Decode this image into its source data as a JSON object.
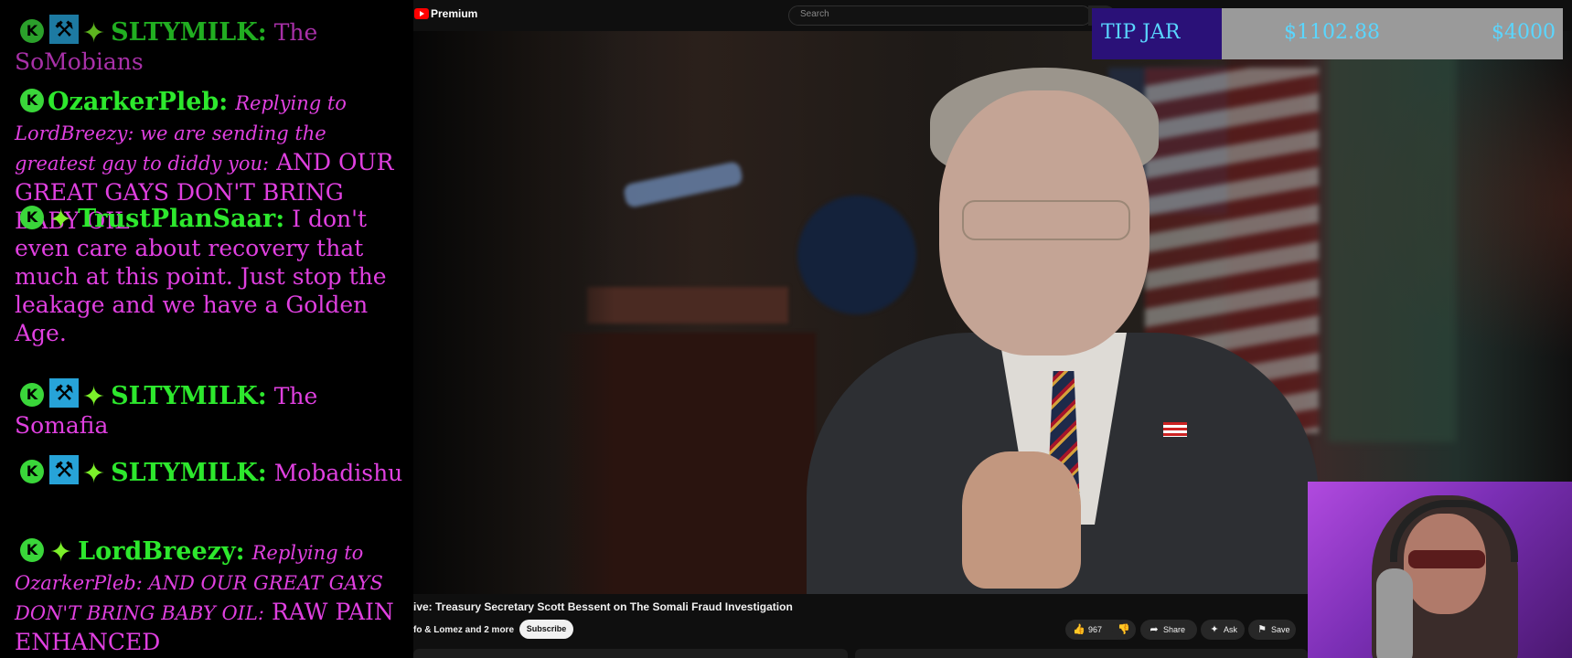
{
  "chat": {
    "messages": [
      {
        "user": "SLTYMILK:",
        "badges": [
          "k-icon",
          "moderator-icon",
          "star-icon"
        ],
        "text": "The SoMobians",
        "dim": true
      },
      {
        "user": "OzarkerPleb:",
        "badges": [
          "k-icon"
        ],
        "reply": "Replying to LordBreezy: we are sending the greatest gay to diddy you:",
        "text": "AND OUR GREAT GAYS DON'T BRING BABY OIL"
      },
      {
        "user": "TrustPlanSaar:",
        "badges": [
          "k-icon",
          "star-icon"
        ],
        "text": "I don't even care about recovery that much at this point. Just stop the leakage and we have a Golden Age."
      },
      {
        "user": "SLTYMILK:",
        "badges": [
          "k-icon",
          "moderator-icon",
          "star-icon"
        ],
        "text": "The Somafia"
      },
      {
        "user": "SLTYMILK:",
        "badges": [
          "k-icon",
          "moderator-icon",
          "star-icon"
        ],
        "text": "Mobadishu"
      },
      {
        "user": "LordBreezy:",
        "badges": [
          "k-icon",
          "star-icon"
        ],
        "reply": "Replying to OzarkerPleb: AND OUR GREAT GAYS DON'T BRING BABY OIL:",
        "text": "RAW PAIN ENHANCED"
      }
    ]
  },
  "youtube": {
    "brand": "Premium",
    "search_placeholder": "Search",
    "video_title": "ive: Treasury Secretary Scott Bessent on The Somali Fraud Investigation",
    "channel": "fo & Lomez and 2 more",
    "subscribe_label": "Subscribe",
    "likes": "967",
    "share_label": "Share",
    "ask_label": "Ask",
    "save_label": "Save"
  },
  "tip_jar": {
    "label": "TIP JAR",
    "current": "$1102.88",
    "goal": "$4000",
    "progress_fraction": 0.276,
    "colors": {
      "label_bg": "#2a1178",
      "bar_bg": "#9a9a9a",
      "text": "#5ad6ff"
    }
  },
  "colors": {
    "username": "#2de82d",
    "message": "#e040e0",
    "badge_k": "#3ad63a",
    "badge_mod": "#27a3d8"
  }
}
